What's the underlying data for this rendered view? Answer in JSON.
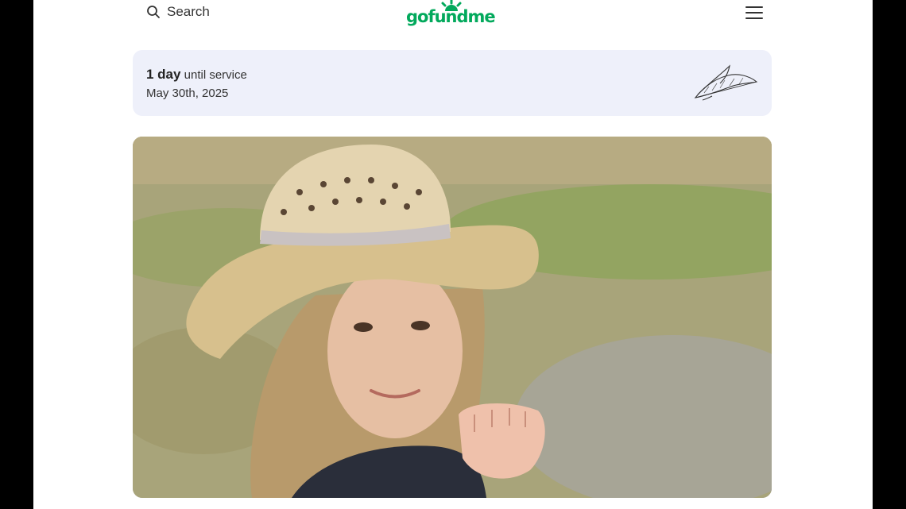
{
  "header": {
    "search_label": "Search",
    "logo_text": "gofundme",
    "menu_icon": "hamburger-menu-icon"
  },
  "service": {
    "days": "1 day",
    "suffix": " until service",
    "date": "May 30th, 2025",
    "icon": "feather-icon"
  },
  "photo": {
    "subject": "photo"
  },
  "colors": {
    "brand_green": "#02a95c",
    "card_bg": "#eef0fa",
    "letterbox": "#000000"
  }
}
